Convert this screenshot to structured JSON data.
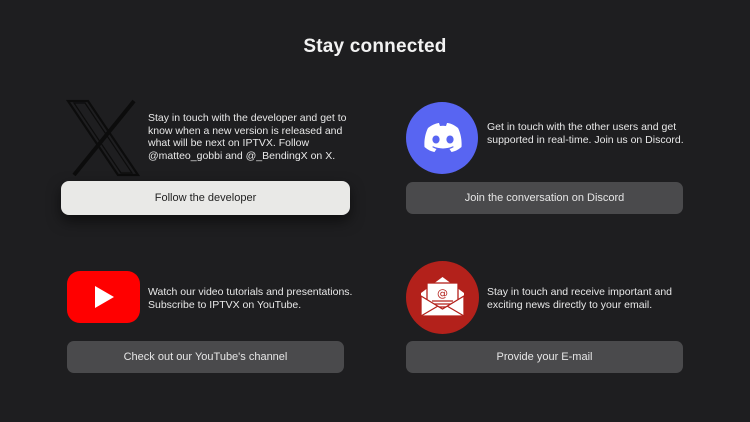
{
  "page": {
    "title": "Stay connected"
  },
  "cards": {
    "x": {
      "icon": "x-logo-icon",
      "description": "Stay in touch with the developer and get to know when a new version is released and what will be next on IPTVX. Follow @matteo_gobbi and @_BendingX on X.",
      "button_label": "Follow the developer",
      "focused": true
    },
    "discord": {
      "icon": "discord-logo-icon",
      "description": "Get in touch with the other users and get supported in real-time. Join us on Discord.",
      "button_label": "Join the conversation on Discord"
    },
    "youtube": {
      "icon": "youtube-logo-icon",
      "description": "Watch our video tutorials and presentations. Subscribe to IPTVX on YouTube.",
      "button_label": "Check out our YouTube's channel"
    },
    "email": {
      "icon": "email-envelope-icon",
      "description": "Stay in touch and receive important and exciting news directly to your email.",
      "button_label": "Provide your E-mail"
    }
  },
  "colors": {
    "background": "#1e1e20",
    "button": "#4a4a4c",
    "button_focused": "#e9e9e7",
    "discord": "#5865f2",
    "youtube": "#ff0000",
    "email": "#b3211b"
  }
}
